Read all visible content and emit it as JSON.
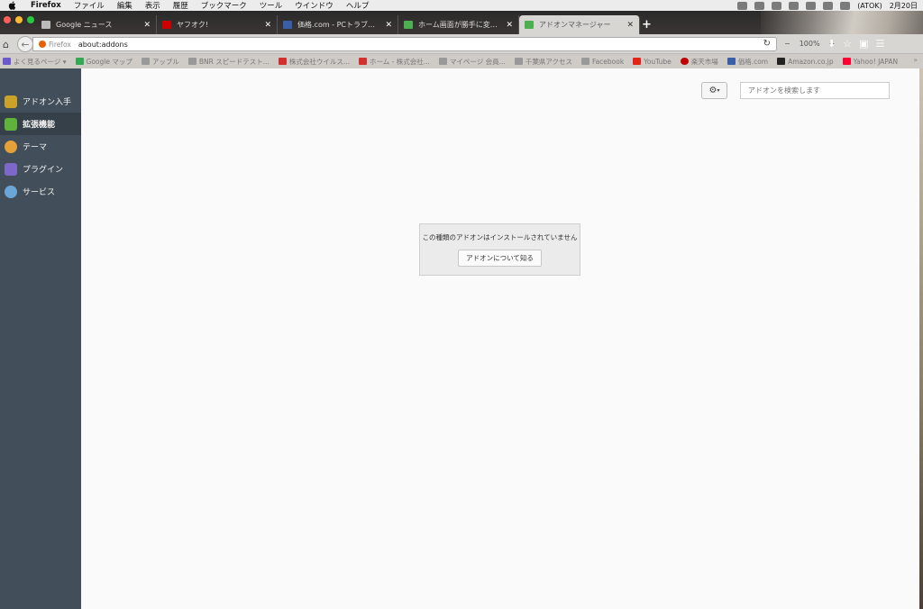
{
  "menubar": {
    "app": "Firefox",
    "items": [
      "ファイル",
      "編集",
      "表示",
      "履歴",
      "ブックマーク",
      "ツール",
      "ウインドウ",
      "ヘルプ"
    ],
    "ime": "(ATOK)",
    "date": "2月20日"
  },
  "tabs": [
    {
      "label": "Google ニュース",
      "favicon_color": "#bbbbbb"
    },
    {
      "label": "ヤフオク!",
      "favicon_color": "#cc0000"
    },
    {
      "label": "価格.com - PCトラブル相談 ...",
      "favicon_color": "#3a5fa8"
    },
    {
      "label": "ホーム画面が勝手に変わるS...",
      "favicon_color": "#4caf50"
    },
    {
      "label": "アドオンマネージャー",
      "favicon_color": "#4caf50"
    }
  ],
  "newtab_label": "+",
  "navbar": {
    "identity_label": "Firefox",
    "url": "about:addons",
    "zoom": "100%"
  },
  "bookmarks": [
    {
      "label": "よく見るページ",
      "color": "#6a5acd"
    },
    {
      "label": "Google マップ",
      "color": "#34a853"
    },
    {
      "label": "アップル",
      "color": "#999999"
    },
    {
      "label": "BNR スピードテスト...",
      "color": "#999999"
    },
    {
      "label": "株式会社ウイルス...",
      "color": "#d32f2f"
    },
    {
      "label": "ホーム - 株式会社...",
      "color": "#d32f2f"
    },
    {
      "label": "マイページ 会員...",
      "color": "#999999"
    },
    {
      "label": "千葉県アクセス",
      "color": "#999999"
    },
    {
      "label": "Facebook",
      "color": "#999999"
    },
    {
      "label": "YouTube",
      "color": "#e62117"
    },
    {
      "label": "楽天市場",
      "color": "#bf0000"
    },
    {
      "label": "価格.com",
      "color": "#3a5fa8"
    },
    {
      "label": "Amazon.co.jp",
      "color": "#222222"
    },
    {
      "label": "Yahoo! JAPAN",
      "color": "#ff0033"
    }
  ],
  "sidebar": {
    "items": [
      {
        "label": "アドオン入手",
        "icon_color": "#c9a227",
        "icon": "bag-icon"
      },
      {
        "label": "拡張機能",
        "icon_color": "#5fb33a",
        "icon": "puzzle-icon"
      },
      {
        "label": "テーマ",
        "icon_color": "#e5a03a",
        "icon": "palette-icon"
      },
      {
        "label": "プラグイン",
        "icon_color": "#7b68c9",
        "icon": "plugin-icon"
      },
      {
        "label": "サービス",
        "icon_color": "#6aa7d8",
        "icon": "cloud-icon"
      }
    ],
    "selected_index": 1
  },
  "search": {
    "placeholder": "アドオンを検索します"
  },
  "empty_state": {
    "message": "この種類のアドオンはインストールされていません",
    "button": "アドオンについて知る"
  }
}
